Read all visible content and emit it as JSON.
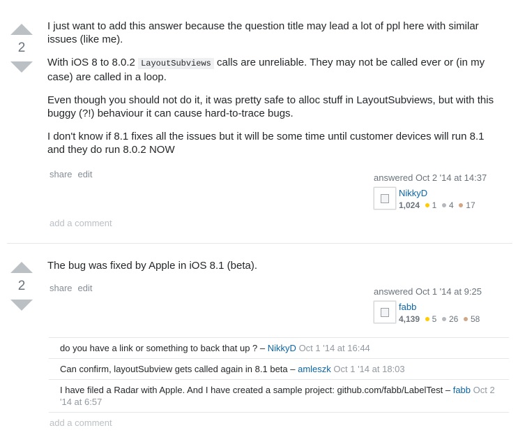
{
  "answers": [
    {
      "votes": "2",
      "paragraphs": [
        {
          "before": "I just want to add this answer because the question title may lead a lot of ppl here with similar issues (like me).",
          "code": "",
          "after": ""
        },
        {
          "before": "With iOS 8 to 8.0.2 ",
          "code": "LayoutSubviews",
          "after": " calls are unreliable. They may not be called ever or (in my case) are called in a loop."
        },
        {
          "before": "Even though you should not do it, it was pretty safe to alloc stuff in LayoutSubviews, but with this buggy (?!) behaviour it can cause hard-to-trace bugs.",
          "code": "",
          "after": ""
        },
        {
          "before": "I don't know if 8.1 fixes all the issues but it will be some time until customer devices will run 8.1 and they do run 8.0.2 NOW",
          "code": "",
          "after": ""
        }
      ],
      "share_label": "share",
      "edit_label": "edit",
      "answered": "answered Oct 2 '14 at 14:37",
      "user": {
        "name": "NikkyD",
        "rep": "1,024",
        "gold": "1",
        "silver": "4",
        "bronze": "17"
      },
      "add_comment": "add a comment"
    },
    {
      "votes": "2",
      "text": "The bug was fixed by Apple in iOS 8.1 (beta).",
      "share_label": "share",
      "edit_label": "edit",
      "answered": "answered Oct 1 '14 at 9:25",
      "user": {
        "name": "fabb",
        "rep": "4,139",
        "gold": "5",
        "silver": "26",
        "bronze": "58"
      },
      "comments": [
        {
          "text": "do you have a link or something to back that up ? –",
          "user": "NikkyD",
          "date": "Oct 1 '14 at 16:44"
        },
        {
          "text": "Can confirm, layoutSubview gets called again in 8.1 beta –",
          "user": "amleszk",
          "date": "Oct 1 '14 at 18:03"
        },
        {
          "text": "I have filed a Radar with Apple. And I have created a sample project: github.com/fabb/LabelTest –",
          "user": "fabb",
          "date": "Oct 2 '14 at 6:57"
        }
      ],
      "add_comment": "add a comment"
    }
  ],
  "colors": {
    "link": "#0c65a5",
    "muted": "#848d95",
    "gold": "#ffcc01",
    "silver": "#b4b8bc",
    "bronze": "#d1a684"
  },
  "icons": [
    "vote-up-icon",
    "vote-down-icon",
    "broken-image-icon",
    "gold-badge-icon",
    "silver-badge-icon",
    "bronze-badge-icon"
  ]
}
